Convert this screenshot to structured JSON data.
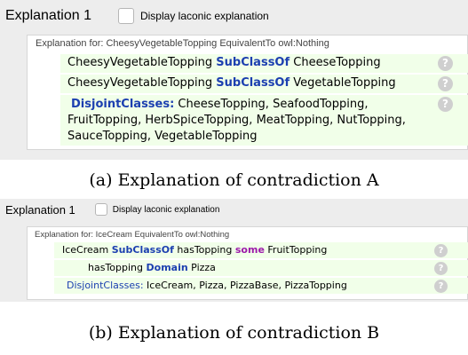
{
  "panel_a": {
    "title": "Explanation 1",
    "checkbox_label": "Display laconic explanation",
    "explanation_for": "Explanation for: CheesyVegetableTopping EquivalentTo owl:Nothing",
    "axioms": [
      {
        "parts": [
          "CheesyVegetableTopping ",
          "SubClassOf",
          " CheeseTopping"
        ]
      },
      {
        "parts": [
          "CheesyVegetableTopping ",
          "SubClassOf",
          " VegetableTopping"
        ]
      },
      {
        "keyword": "DisjointClasses:",
        "line1": " CheeseTopping, SeafoodTopping,",
        "line2": "FruitTopping, HerbSpiceTopping, MeatTopping, NutTopping,",
        "line3": "SauceTopping, VegetableTopping"
      }
    ],
    "help_symbol": "?",
    "caption": "(a) Explanation of contradiction A"
  },
  "panel_b": {
    "title": "Explanation 1",
    "checkbox_label": "Display laconic explanation",
    "explanation_for": "Explanation for: IceCream EquivalentTo owl:Nothing",
    "axioms": [
      {
        "parts": [
          "IceCream ",
          "SubClassOf",
          " hasTopping ",
          "some",
          " FruitTopping"
        ]
      },
      {
        "parts": [
          "hasTopping ",
          "Domain",
          " Pizza"
        ]
      },
      {
        "parts": [
          "DisjointClasses:",
          " IceCream, Pizza, PizzaBase, PizzaTopping"
        ]
      }
    ],
    "help_symbol": "?",
    "caption": "(b) Explanation of contradiction B"
  }
}
